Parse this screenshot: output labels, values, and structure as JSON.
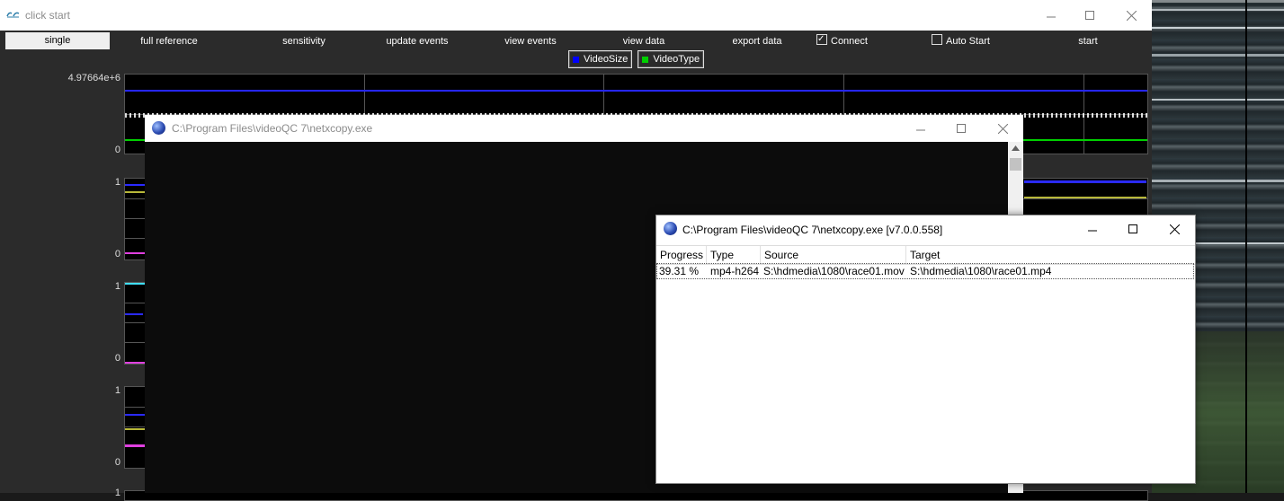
{
  "main_window": {
    "title": "click start",
    "toolbar": {
      "single": "single",
      "full_reference": "full reference",
      "sensitivity": "sensitivity",
      "update_events": "update events",
      "view_events": "view events",
      "view_data": "view data",
      "export_data": "export data",
      "connect": "Connect",
      "connect_checked": true,
      "auto_start": "Auto Start",
      "auto_start_checked": false,
      "start": "start"
    },
    "legend": [
      {
        "name": "VideoSize",
        "color": "#0000ff"
      },
      {
        "name": "VideoType",
        "color": "#00d000"
      }
    ],
    "plots": [
      {
        "ymax": "4.97664e+6",
        "ymin": "0"
      },
      {
        "ymax": "1",
        "ymin": "0"
      },
      {
        "ymax": "1",
        "ymin": "0"
      },
      {
        "ymax": "1",
        "ymin": "0"
      },
      {
        "ymax": "1",
        "ymin": ""
      }
    ]
  },
  "netxcopy_console": {
    "title": "C:\\Program Files\\videoQC 7\\netxcopy.exe"
  },
  "netxcopy_progress": {
    "title": "C:\\Program Files\\videoQC 7\\netxcopy.exe [v7.0.0.558]",
    "columns": [
      "Progress",
      "Type",
      "Source",
      "Target"
    ],
    "rows": [
      {
        "progress": "39.31 %",
        "type": "mp4-h264",
        "source": "S:\\hdmedia\\1080\\race01.mov",
        "target": "S:\\hdmedia\\1080\\race01.mp4"
      }
    ]
  },
  "icons": {
    "minimize": "minimize-icon",
    "maximize": "maximize-icon",
    "close": "close-icon",
    "app": "videoqc-app-icon",
    "globe": "netxcopy-globe-icon"
  }
}
